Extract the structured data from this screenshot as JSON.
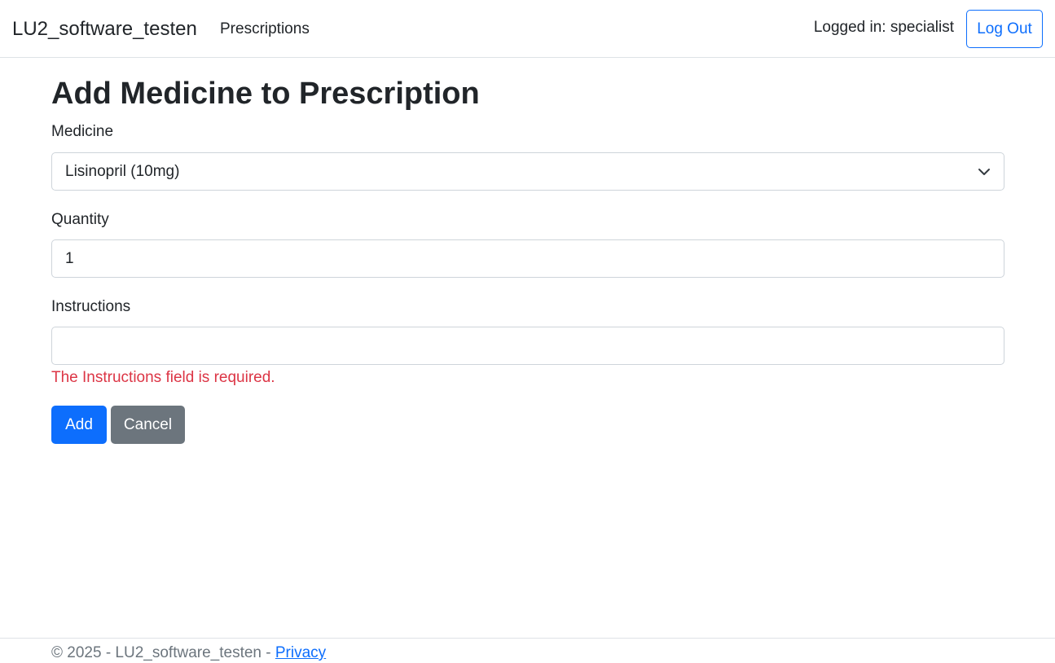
{
  "navbar": {
    "brand": "LU2_software_testen",
    "links": [
      {
        "label": "Prescriptions"
      }
    ],
    "login_status": "Logged in: specialist",
    "logout_label": "Log Out"
  },
  "page": {
    "title": "Add Medicine to Prescription"
  },
  "form": {
    "medicine": {
      "label": "Medicine",
      "selected": "Lisinopril (10mg)"
    },
    "quantity": {
      "label": "Quantity",
      "value": "1"
    },
    "instructions": {
      "label": "Instructions",
      "value": "",
      "error": "The Instructions field is required."
    },
    "buttons": {
      "add": "Add",
      "cancel": "Cancel"
    }
  },
  "footer": {
    "text": "© 2025 - LU2_software_testen - ",
    "privacy_label": "Privacy"
  },
  "colors": {
    "primary": "#0d6efd",
    "secondary": "#6c757d",
    "danger": "#dc3545",
    "text": "#212529",
    "border": "#dee2e6"
  },
  "icons": {
    "select_indicator": "chevron-down-icon"
  }
}
